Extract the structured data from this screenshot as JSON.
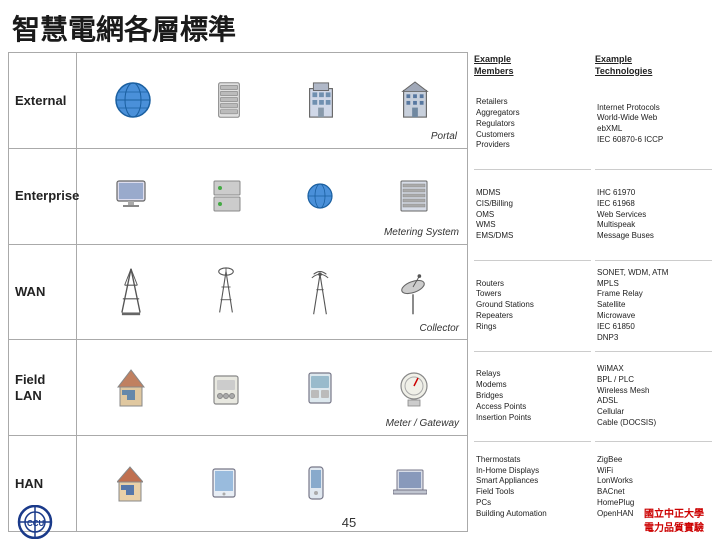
{
  "title": "智慧電網各層標準",
  "header": {
    "col1": "Example\nMembers",
    "col2": "Example\nTechnologies"
  },
  "layers": [
    {
      "id": "external",
      "label": "External",
      "sublabel": "",
      "members": [
        "Retailers",
        "Aggregators",
        "Regulators",
        "Customers",
        "Providers"
      ],
      "technologies": [
        "Internet Protocols",
        "World-Wide Web",
        "ebXML",
        "IEC 60870-6 ICCP"
      ],
      "diagram_label": "Portal"
    },
    {
      "id": "enterprise",
      "label": "Enterprise",
      "sublabel": "",
      "members": [
        "MDMS",
        "CIS/Billing",
        "OMS",
        "WMS",
        "EMS/DMS"
      ],
      "technologies": [
        "IHC 61970",
        "IEC 61968",
        "Web Services",
        "Multispeak",
        "Message Buses"
      ],
      "diagram_label": "Metering System"
    },
    {
      "id": "wan",
      "label": "WAN",
      "sublabel": "",
      "members": [
        "Routers",
        "Towers",
        "Ground Stations",
        "Repeaters",
        "Rings"
      ],
      "technologies": [
        "SONET, WDM, ATM",
        "MPLS",
        "Frame Relay",
        "Satellite",
        "Microwave",
        "IEC 61850",
        "DNP3"
      ],
      "diagram_label": "Collector"
    },
    {
      "id": "fieldlan",
      "label": "Field\nLAN",
      "sublabel": "",
      "members": [
        "Relays",
        "Modems",
        "Bridges",
        "Access Points",
        "Insertion Points"
      ],
      "technologies": [
        "WiMAX",
        "BPL / PLC",
        "Wireless Mesh",
        "ADSL",
        "Cellular",
        "Cable (DOCSIS)"
      ],
      "diagram_label": "Meter / Gateway"
    },
    {
      "id": "han",
      "label": "HAN",
      "sublabel": "",
      "members": [
        "Thermostats",
        "In-Home Displays",
        "Smart Appliances",
        "Field Tools",
        "PCs",
        "Building Automation"
      ],
      "technologies": [
        "ZigBee",
        "WiFi",
        "LonWorks",
        "BACnet",
        "HomePlug",
        "OpenHAN"
      ],
      "diagram_label": ""
    }
  ],
  "footer": {
    "page_number": "45",
    "university": "國立中正大學\n電力品質實驗"
  }
}
